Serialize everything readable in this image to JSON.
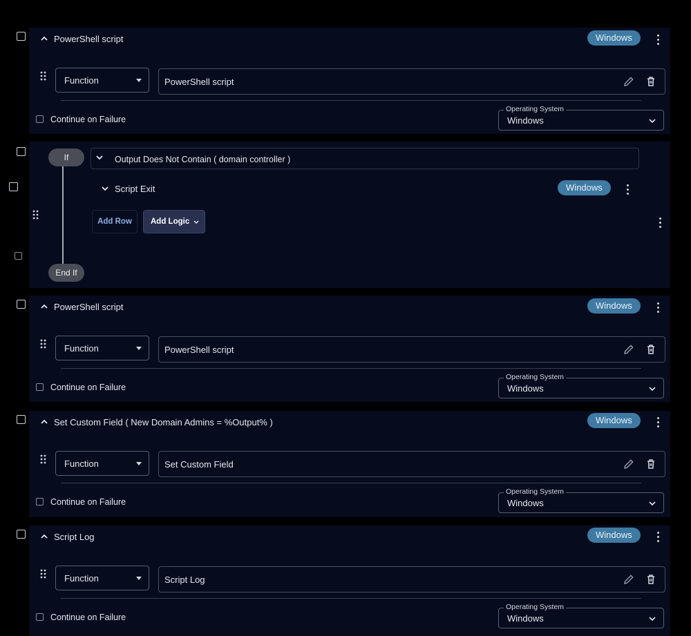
{
  "steps": [
    {
      "title": "PowerShell script",
      "badge": "Windows",
      "type_select": "Function",
      "field_value": "PowerShell script",
      "continue_label": "Continue on Failure",
      "os_legend": "Operating System",
      "os_value": "Windows"
    },
    {
      "title": "PowerShell script",
      "badge": "Windows",
      "type_select": "Function",
      "field_value": "PowerShell script",
      "continue_label": "Continue on Failure",
      "os_legend": "Operating System",
      "os_value": "Windows"
    },
    {
      "title": "Set Custom Field ( New Domain Admins = %Output% )",
      "badge": "Windows",
      "type_select": "Function",
      "field_value": "Set Custom Field",
      "continue_label": "Continue on Failure",
      "os_legend": "Operating System",
      "os_value": "Windows"
    },
    {
      "title": "Script Log",
      "badge": "Windows",
      "type_select": "Function",
      "field_value": "Script Log",
      "continue_label": "Continue on Failure",
      "os_legend": "Operating System",
      "os_value": "Windows"
    }
  ],
  "logic_block": {
    "if_label": "If",
    "end_if_label": "End If",
    "condition": "Output Does Not Contain ( domain controller )",
    "nested_title": "Script Exit",
    "nested_badge": "Windows",
    "add_row_label": "Add Row",
    "add_logic_label": "Add Logic"
  },
  "colors": {
    "background": "#000000",
    "card": "#060b1e",
    "badge": "#3f7aa3",
    "add_logic_button": "#2a3150",
    "add_row_text": "#8fb0e8"
  },
  "icons": {
    "collapse": "chevron-up-icon",
    "expand": "chevron-down-icon",
    "drag": "drag-handle-icon",
    "menu": "kebab-menu-icon",
    "edit": "pencil-icon",
    "delete": "trash-icon"
  }
}
